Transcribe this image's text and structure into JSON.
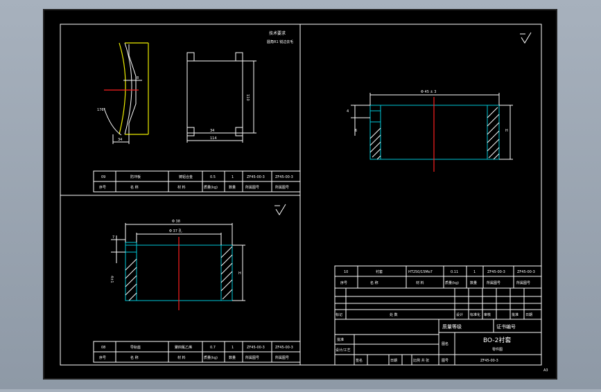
{
  "views": {
    "top_left": {
      "tech_req_title": "技术要求",
      "tech_req_line": "圆角R1 锐边去毛",
      "dims": {
        "width_small": "34",
        "width_big": "114",
        "height": "110",
        "angle": "176°",
        "gap": "8"
      }
    },
    "right": {
      "dia_label": "Φ 45 ± 3",
      "height_label": "H",
      "small_label": "4",
      "side_label": "6"
    },
    "bottom_left": {
      "dia_outer": "Φ 38",
      "dia_inner": "Φ 37 孔",
      "left_a": "7",
      "left_b": "4±1",
      "height_label": "H"
    }
  },
  "parts_table_a": {
    "row": [
      "09",
      "防冲板",
      "铸铝合金",
      "0.5",
      "1",
      "ZF45-00-3",
      "ZF45-00-3"
    ],
    "header": [
      "序号",
      "名   称",
      "材  料",
      "质量(kg)",
      "数量",
      "所属图号",
      "所属图号"
    ]
  },
  "parts_table_b": {
    "row": [
      "08",
      "导轨座",
      "聚四氟乙烯",
      "0.7",
      "1",
      "ZF45-00-3",
      "ZF45-00-3"
    ],
    "header": [
      "序号",
      "名   称",
      "材  料",
      "质量(kg)",
      "数量",
      "所属图号",
      "所属图号"
    ]
  },
  "title_block": {
    "part_row": [
      "10",
      "衬套",
      "HT250/15Mo7",
      "0.11",
      "1",
      "ZF45-00-3",
      "ZF45-00-3"
    ],
    "part_header": [
      "序号",
      "名   称",
      "材  料",
      "质量(kg)",
      "数量",
      "所属图号",
      "所属图号"
    ],
    "rev_header": [
      "标记",
      "处 数",
      "设计",
      "标准化",
      "审核",
      "批准",
      "日期"
    ],
    "grade_label": "质量等级",
    "cert_label": "证书编号",
    "approve_label": "批准",
    "design_label": "设计/工艺",
    "name_label": "图名",
    "drawing_title": "BO-2衬套",
    "drawing_sub": "零件图",
    "draw_no_label": "图号",
    "draw_no": "ZF45-00-3",
    "bottom_labels": [
      "签名",
      "日期",
      "比例 共 张"
    ]
  },
  "sheet_no": "A3"
}
